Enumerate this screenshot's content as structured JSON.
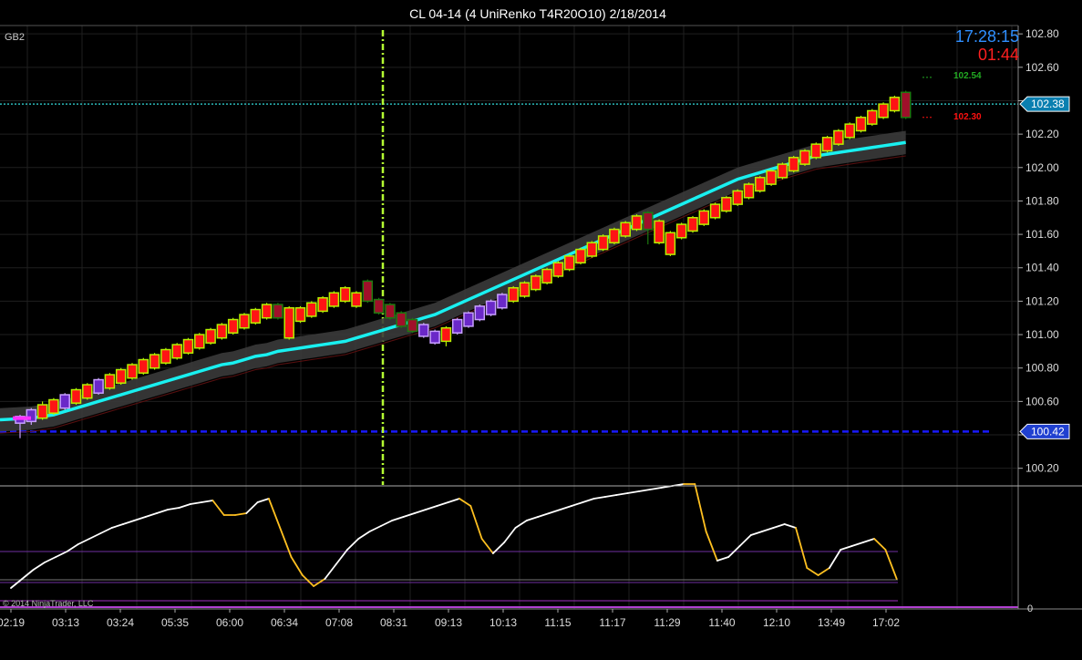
{
  "window": {
    "title": "CL 04-14 (4 UniRenko T4R20O10)  2/18/2014",
    "panel_label": "GB2",
    "copyright": "© 2014 NinjaTrader, LLC"
  },
  "clock": {
    "time": "17:28:15",
    "countdown": "01:44"
  },
  "price_levels": {
    "current": "102.38",
    "lower": "100.42",
    "upper_target": "102.54",
    "lower_target": "102.30"
  },
  "colors": {
    "up_fill": "#ff1414",
    "up_border": "#b4f000",
    "down_fill": "#a0102a",
    "down_border": "#1e7a10",
    "purple_fill": "#6a28c8",
    "purple_border": "#c8a0ff",
    "ma_line": "#19f0f0",
    "ma_band": "#3a3a3a",
    "current_line": "#33dddd",
    "level_line": "#1a1aff",
    "vline": "#b4ff32",
    "osc_up": "#ffffff",
    "osc_down": "#ffc020",
    "clock_time": "#2f8fff",
    "clock_countdown": "#ff2020",
    "target_up": "#22aa22",
    "target_down": "#ff1010"
  },
  "chart_data": {
    "type": "candlestick",
    "title": "CL 04-14 (4 UniRenko T4R20O10)  2/18/2014",
    "y_ticks": [
      "102.80",
      "102.60",
      "102.40",
      "102.20",
      "102.00",
      "101.80",
      "101.60",
      "101.40",
      "101.20",
      "101.00",
      "100.80",
      "100.60",
      "100.40",
      "100.20"
    ],
    "y_range": [
      100.1,
      102.85
    ],
    "x_labels": [
      "02:19",
      "03:13",
      "03:24",
      "05:35",
      "06:00",
      "06:34",
      "07:08",
      "08:31",
      "09:13",
      "10:13",
      "11:15",
      "11:17",
      "11:29",
      "11:40",
      "12:10",
      "13:49",
      "17:02"
    ],
    "bar_count": 80,
    "bars": [
      {
        "o": 100.51,
        "c": 100.47,
        "h": 100.52,
        "l": 100.38,
        "t": "purple"
      },
      {
        "o": 100.48,
        "c": 100.55,
        "h": 100.56,
        "l": 100.46,
        "t": "purple"
      },
      {
        "o": 100.5,
        "c": 100.58,
        "h": 100.6,
        "l": 100.49,
        "t": "up"
      },
      {
        "o": 100.53,
        "c": 100.61,
        "h": 100.62,
        "l": 100.52,
        "t": "up"
      },
      {
        "o": 100.56,
        "c": 100.64,
        "h": 100.65,
        "l": 100.55,
        "t": "purple"
      },
      {
        "o": 100.59,
        "c": 100.67,
        "h": 100.68,
        "l": 100.58,
        "t": "up"
      },
      {
        "o": 100.62,
        "c": 100.7,
        "h": 100.71,
        "l": 100.61,
        "t": "up"
      },
      {
        "o": 100.65,
        "c": 100.73,
        "h": 100.74,
        "l": 100.64,
        "t": "purple"
      },
      {
        "o": 100.68,
        "c": 100.76,
        "h": 100.77,
        "l": 100.67,
        "t": "up"
      },
      {
        "o": 100.71,
        "c": 100.79,
        "h": 100.8,
        "l": 100.7,
        "t": "up"
      },
      {
        "o": 100.74,
        "c": 100.82,
        "h": 100.83,
        "l": 100.73,
        "t": "up"
      },
      {
        "o": 100.77,
        "c": 100.85,
        "h": 100.86,
        "l": 100.76,
        "t": "up"
      },
      {
        "o": 100.8,
        "c": 100.88,
        "h": 100.89,
        "l": 100.79,
        "t": "up"
      },
      {
        "o": 100.83,
        "c": 100.91,
        "h": 100.92,
        "l": 100.82,
        "t": "up"
      },
      {
        "o": 100.86,
        "c": 100.94,
        "h": 100.95,
        "l": 100.85,
        "t": "up"
      },
      {
        "o": 100.89,
        "c": 100.97,
        "h": 100.98,
        "l": 100.88,
        "t": "up"
      },
      {
        "o": 100.92,
        "c": 101.0,
        "h": 101.01,
        "l": 100.91,
        "t": "up"
      },
      {
        "o": 100.95,
        "c": 101.03,
        "h": 101.04,
        "l": 100.94,
        "t": "up"
      },
      {
        "o": 100.98,
        "c": 101.06,
        "h": 101.07,
        "l": 100.97,
        "t": "up"
      },
      {
        "o": 101.01,
        "c": 101.09,
        "h": 101.1,
        "l": 101.0,
        "t": "up"
      },
      {
        "o": 101.04,
        "c": 101.12,
        "h": 101.13,
        "l": 101.03,
        "t": "up"
      },
      {
        "o": 101.07,
        "c": 101.15,
        "h": 101.16,
        "l": 101.06,
        "t": "up"
      },
      {
        "o": 101.1,
        "c": 101.18,
        "h": 101.19,
        "l": 101.09,
        "t": "up"
      },
      {
        "o": 101.18,
        "c": 101.1,
        "h": 101.19,
        "l": 101.09,
        "t": "down"
      },
      {
        "o": 101.16,
        "c": 100.98,
        "h": 101.17,
        "l": 100.97,
        "t": "up"
      },
      {
        "o": 101.08,
        "c": 101.16,
        "h": 101.17,
        "l": 101.07,
        "t": "up"
      },
      {
        "o": 101.11,
        "c": 101.19,
        "h": 101.2,
        "l": 101.1,
        "t": "up"
      },
      {
        "o": 101.14,
        "c": 101.22,
        "h": 101.23,
        "l": 101.13,
        "t": "up"
      },
      {
        "o": 101.17,
        "c": 101.25,
        "h": 101.26,
        "l": 101.16,
        "t": "up"
      },
      {
        "o": 101.2,
        "c": 101.28,
        "h": 101.29,
        "l": 101.19,
        "t": "up"
      },
      {
        "o": 101.25,
        "c": 101.17,
        "h": 101.26,
        "l": 101.16,
        "t": "up"
      },
      {
        "o": 101.32,
        "c": 101.2,
        "h": 101.33,
        "l": 101.19,
        "t": "down"
      },
      {
        "o": 101.21,
        "c": 101.13,
        "h": 101.22,
        "l": 101.12,
        "t": "down"
      },
      {
        "o": 101.18,
        "c": 101.1,
        "h": 101.19,
        "l": 101.09,
        "t": "down"
      },
      {
        "o": 101.13,
        "c": 101.05,
        "h": 101.14,
        "l": 101.04,
        "t": "down"
      },
      {
        "o": 101.09,
        "c": 101.02,
        "h": 101.1,
        "l": 101.01,
        "t": "down"
      },
      {
        "o": 101.06,
        "c": 100.99,
        "h": 101.07,
        "l": 100.98,
        "t": "purple"
      },
      {
        "o": 101.02,
        "c": 100.95,
        "h": 101.03,
        "l": 100.94,
        "t": "purple"
      },
      {
        "o": 100.96,
        "c": 101.04,
        "h": 101.05,
        "l": 100.93,
        "t": "up"
      },
      {
        "o": 101.01,
        "c": 101.09,
        "h": 101.1,
        "l": 101.0,
        "t": "purple"
      },
      {
        "o": 101.05,
        "c": 101.13,
        "h": 101.14,
        "l": 101.04,
        "t": "purple"
      },
      {
        "o": 101.09,
        "c": 101.17,
        "h": 101.18,
        "l": 101.08,
        "t": "purple"
      },
      {
        "o": 101.12,
        "c": 101.2,
        "h": 101.21,
        "l": 101.11,
        "t": "purple"
      },
      {
        "o": 101.16,
        "c": 101.24,
        "h": 101.25,
        "l": 101.15,
        "t": "purple"
      },
      {
        "o": 101.2,
        "c": 101.28,
        "h": 101.29,
        "l": 101.19,
        "t": "up"
      },
      {
        "o": 101.23,
        "c": 101.31,
        "h": 101.32,
        "l": 101.22,
        "t": "up"
      },
      {
        "o": 101.27,
        "c": 101.35,
        "h": 101.36,
        "l": 101.26,
        "t": "up"
      },
      {
        "o": 101.31,
        "c": 101.39,
        "h": 101.4,
        "l": 101.3,
        "t": "up"
      },
      {
        "o": 101.35,
        "c": 101.43,
        "h": 101.44,
        "l": 101.34,
        "t": "up"
      },
      {
        "o": 101.39,
        "c": 101.47,
        "h": 101.48,
        "l": 101.38,
        "t": "up"
      },
      {
        "o": 101.43,
        "c": 101.51,
        "h": 101.52,
        "l": 101.42,
        "t": "up"
      },
      {
        "o": 101.47,
        "c": 101.55,
        "h": 101.56,
        "l": 101.46,
        "t": "up"
      },
      {
        "o": 101.51,
        "c": 101.59,
        "h": 101.6,
        "l": 101.5,
        "t": "up"
      },
      {
        "o": 101.55,
        "c": 101.63,
        "h": 101.64,
        "l": 101.54,
        "t": "up"
      },
      {
        "o": 101.59,
        "c": 101.67,
        "h": 101.68,
        "l": 101.58,
        "t": "up"
      },
      {
        "o": 101.63,
        "c": 101.71,
        "h": 101.72,
        "l": 101.62,
        "t": "up"
      },
      {
        "o": 101.73,
        "c": 101.63,
        "h": 101.74,
        "l": 101.54,
        "t": "down"
      },
      {
        "o": 101.68,
        "c": 101.55,
        "h": 101.69,
        "l": 101.54,
        "t": "up"
      },
      {
        "o": 101.61,
        "c": 101.48,
        "h": 101.62,
        "l": 101.47,
        "t": "up"
      },
      {
        "o": 101.58,
        "c": 101.66,
        "h": 101.67,
        "l": 101.57,
        "t": "up"
      },
      {
        "o": 101.62,
        "c": 101.7,
        "h": 101.71,
        "l": 101.61,
        "t": "up"
      },
      {
        "o": 101.66,
        "c": 101.74,
        "h": 101.75,
        "l": 101.65,
        "t": "up"
      },
      {
        "o": 101.7,
        "c": 101.78,
        "h": 101.79,
        "l": 101.69,
        "t": "up"
      },
      {
        "o": 101.74,
        "c": 101.82,
        "h": 101.83,
        "l": 101.73,
        "t": "up"
      },
      {
        "o": 101.78,
        "c": 101.86,
        "h": 101.87,
        "l": 101.77,
        "t": "up"
      },
      {
        "o": 101.82,
        "c": 101.9,
        "h": 101.91,
        "l": 101.81,
        "t": "up"
      },
      {
        "o": 101.86,
        "c": 101.94,
        "h": 101.95,
        "l": 101.85,
        "t": "up"
      },
      {
        "o": 101.9,
        "c": 101.98,
        "h": 101.99,
        "l": 101.89,
        "t": "up"
      },
      {
        "o": 101.94,
        "c": 102.02,
        "h": 102.03,
        "l": 101.93,
        "t": "up"
      },
      {
        "o": 101.98,
        "c": 102.06,
        "h": 102.07,
        "l": 101.97,
        "t": "up"
      },
      {
        "o": 102.02,
        "c": 102.1,
        "h": 102.11,
        "l": 102.01,
        "t": "up"
      },
      {
        "o": 102.06,
        "c": 102.14,
        "h": 102.15,
        "l": 102.05,
        "t": "up"
      },
      {
        "o": 102.1,
        "c": 102.18,
        "h": 102.19,
        "l": 102.09,
        "t": "up"
      },
      {
        "o": 102.14,
        "c": 102.22,
        "h": 102.23,
        "l": 102.13,
        "t": "up"
      },
      {
        "o": 102.18,
        "c": 102.26,
        "h": 102.27,
        "l": 102.17,
        "t": "up"
      },
      {
        "o": 102.22,
        "c": 102.3,
        "h": 102.31,
        "l": 102.21,
        "t": "up"
      },
      {
        "o": 102.26,
        "c": 102.34,
        "h": 102.35,
        "l": 102.25,
        "t": "up"
      },
      {
        "o": 102.3,
        "c": 102.38,
        "h": 102.39,
        "l": 102.29,
        "t": "up"
      },
      {
        "o": 102.34,
        "c": 102.42,
        "h": 102.43,
        "l": 102.33,
        "t": "up"
      },
      {
        "o": 102.45,
        "c": 102.3,
        "h": 102.46,
        "l": 102.29,
        "t": "down"
      }
    ],
    "moving_average": [
      100.49,
      100.5,
      100.51,
      100.52,
      100.54,
      100.56,
      100.58,
      100.6,
      100.62,
      100.64,
      100.66,
      100.68,
      100.7,
      100.72,
      100.74,
      100.76,
      100.78,
      100.8,
      100.82,
      100.83,
      100.85,
      100.87,
      100.88,
      100.9,
      100.91,
      100.92,
      100.93,
      100.94,
      100.95,
      100.96,
      100.98,
      101.0,
      101.02,
      101.04,
      101.06,
      101.08,
      101.1,
      101.12,
      101.15,
      101.18,
      101.21,
      101.24,
      101.27,
      101.3,
      101.33,
      101.36,
      101.39,
      101.42,
      101.45,
      101.48,
      101.51,
      101.54,
      101.57,
      101.6,
      101.63,
      101.66,
      101.69,
      101.72,
      101.75,
      101.78,
      101.81,
      101.84,
      101.87,
      101.9,
      101.93,
      101.95,
      101.97,
      101.99,
      102.01,
      102.03,
      102.05,
      102.07,
      102.08,
      102.09,
      102.1,
      102.11,
      102.12,
      102.13,
      102.14,
      102.15
    ],
    "oscillator": {
      "y_label": "0",
      "values": [
        5,
        10,
        15,
        19,
        22,
        25,
        29,
        32,
        35,
        38,
        40,
        42,
        44,
        46,
        48,
        49,
        51,
        52,
        53,
        45,
        45,
        46,
        52,
        54,
        38,
        22,
        12,
        6,
        10,
        18,
        26,
        32,
        36,
        39,
        42,
        44,
        46,
        48,
        50,
        52,
        54,
        50,
        32,
        24,
        30,
        38,
        42,
        44,
        46,
        48,
        50,
        52,
        54,
        55,
        56,
        57,
        58,
        59,
        60,
        61,
        62,
        62,
        36,
        20,
        22,
        28,
        34,
        36,
        38,
        40,
        38,
        16,
        12,
        16,
        26,
        28,
        30,
        32,
        26,
        10
      ],
      "down_segments": [
        [
          18,
          21
        ],
        [
          23,
          28
        ],
        [
          40,
          43
        ],
        [
          60,
          63
        ],
        [
          70,
          73
        ],
        [
          77,
          79
        ]
      ],
      "reference_levels": [
        25,
        8,
        -2
      ]
    }
  }
}
